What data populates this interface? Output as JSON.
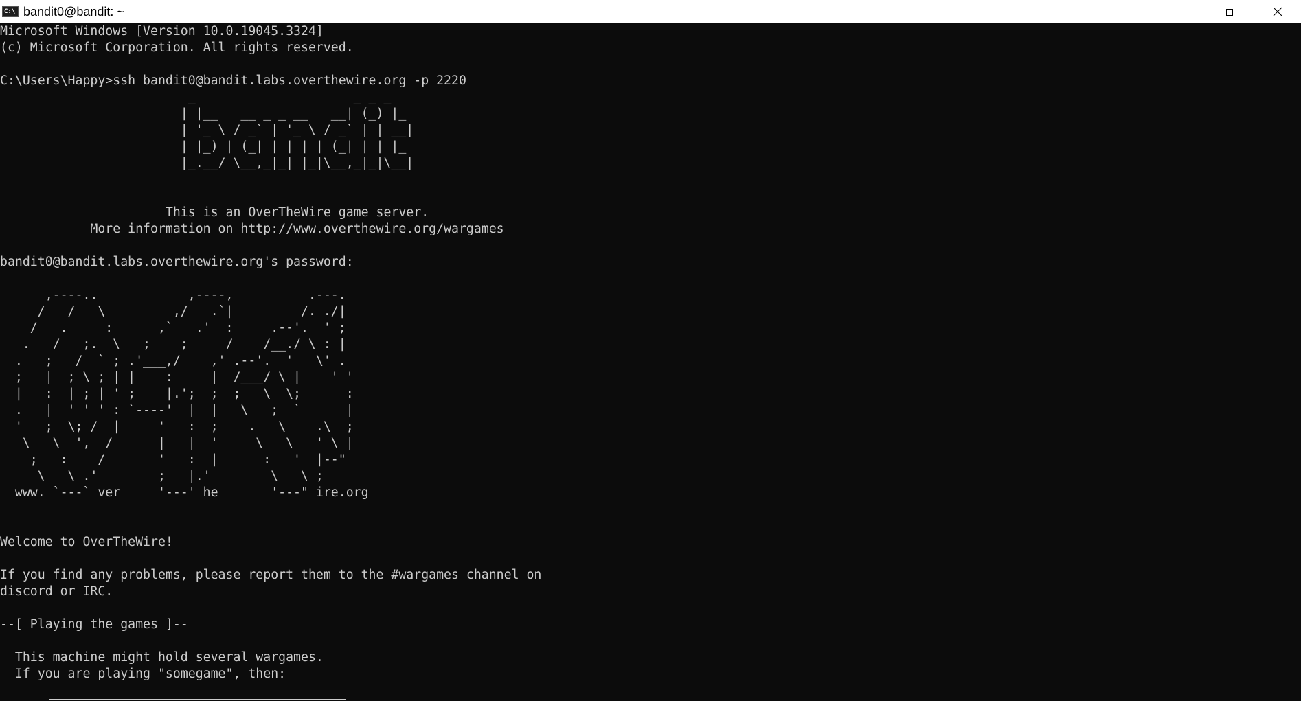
{
  "window": {
    "title": "bandit0@bandit: ~",
    "icon": "cmd-icon",
    "controls": [
      "minimize-icon",
      "restore-icon",
      "close-icon"
    ]
  },
  "terminal": {
    "lines": [
      "Microsoft Windows [Version 10.0.19045.3324]",
      "(c) Microsoft Corporation. All rights reserved.",
      "",
      "C:\\Users\\Happy>ssh bandit0@bandit.labs.overthewire.org -p 2220",
      "                         _                     _ _ _   ",
      "                        | |__   __ _ _ __   __| (_) |_ ",
      "                        | '_ \\ / _` | '_ \\ / _` | | __|",
      "                        | |_) | (_| | | | | (_| | | |_ ",
      "                        |_.__/ \\__,_|_| |_|\\__,_|_|\\__|",
      "",
      "",
      "                      This is an OverTheWire game server.",
      "            More information on http://www.overthewire.org/wargames",
      "",
      "bandit0@bandit.labs.overthewire.org's password:",
      "",
      "      ,----..            ,----,          .---.",
      "     /   /   \\         ,/   .`|         /. ./|",
      "    /   .     :      ,`   .'  :     .--'.  ' ;",
      "   .   /   ;.  \\   ;    ;     /    /__./ \\ : |",
      "  .   ;   /  ` ; .'___,/    ,' .--'.  '   \\' .",
      "  ;   |  ; \\ ; | |    :     |  /___/ \\ |    ' '",
      "  |   :  | ; | ' ;    |.';  ;  ;   \\  \\;      :",
      "  .   |  ' ' ' : `----'  |  |   \\   ;  `      |",
      "  '   ;  \\; /  |     '   :  ;    .   \\    .\\  ;",
      "   \\   \\  ',  /      |   |  '     \\   \\   ' \\ |",
      "    ;   :    /       '   :  |      :   '  |--\"",
      "     \\   \\ .'        ;   |.'        \\   \\ ;",
      "  www. `---` ver     '---' he       '---\" ire.org",
      "",
      "",
      "Welcome to OverTheWire!",
      "",
      "If you find any problems, please report them to the #wargames channel on",
      "discord or IRC.",
      "",
      "--[ Playing the games ]--",
      "",
      "  This machine might hold several wargames.",
      "  If you are playing \"somegame\", then:"
    ]
  },
  "colors": {
    "background": "#0c0c0c",
    "foreground": "#cccccc",
    "titlebar": "#ffffff"
  }
}
